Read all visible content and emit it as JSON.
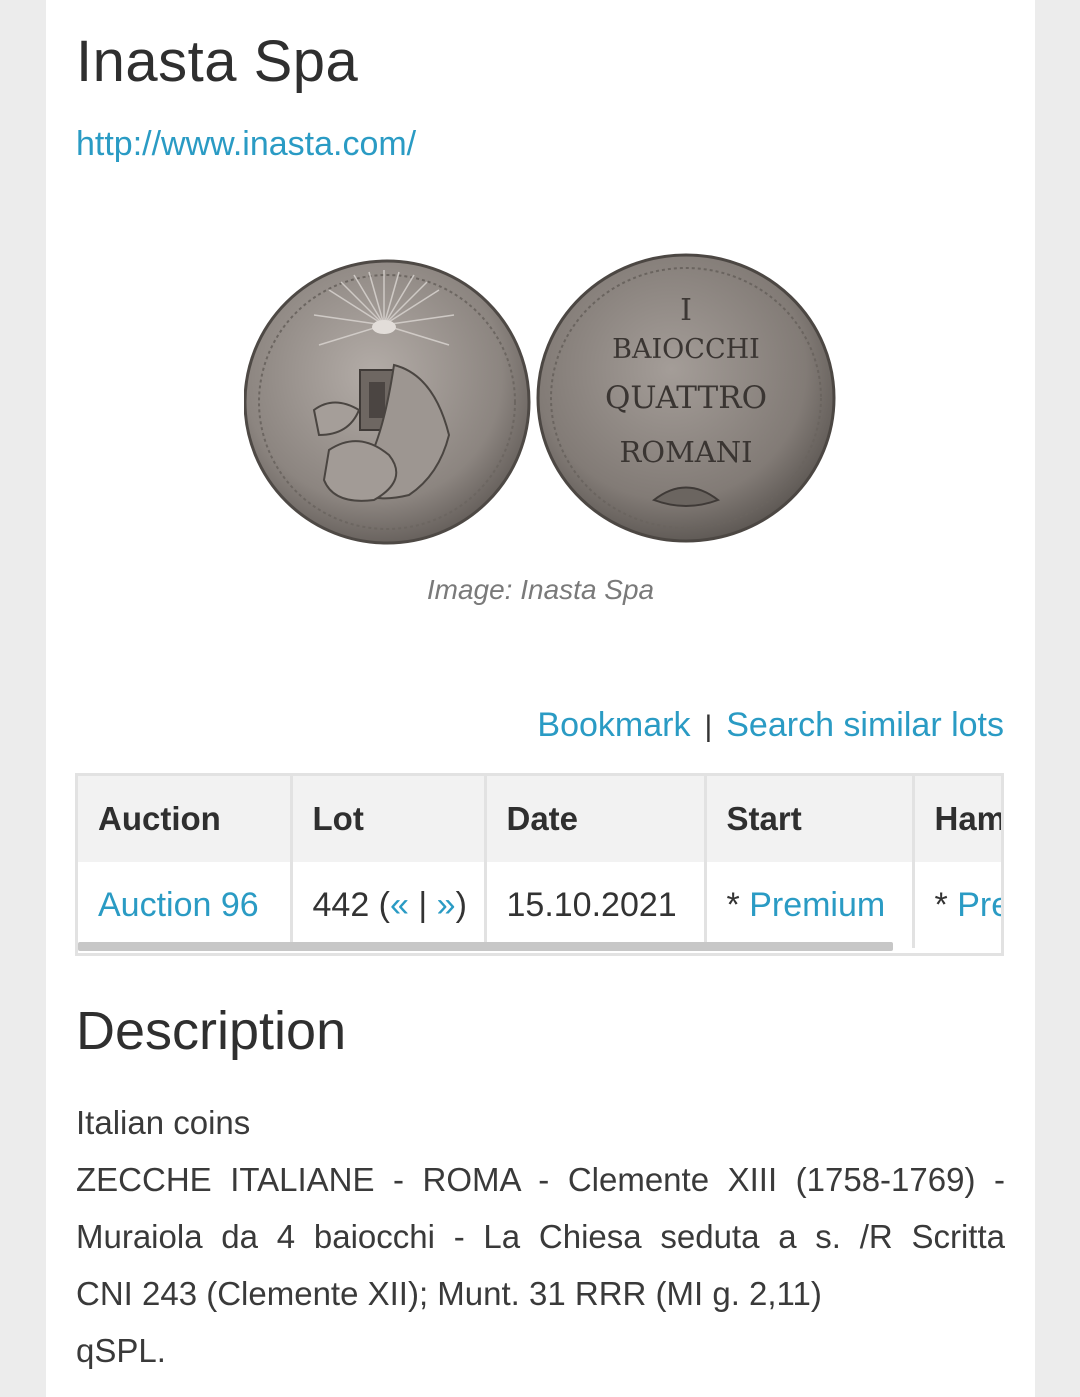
{
  "header": {
    "title": "Inasta Spa",
    "url": "http://www.inasta.com/"
  },
  "image": {
    "caption": "Image: Inasta Spa",
    "reverse_lines": [
      "BAIOCCHI",
      "QUATTRO",
      "ROMANI"
    ],
    "coin_color": "#8c8580"
  },
  "actions": {
    "bookmark": "Bookmark",
    "separator": "|",
    "search_similar": "Search similar lots"
  },
  "table": {
    "headers": [
      "Auction",
      "Lot",
      "Date",
      "Start",
      "Ham"
    ],
    "row": {
      "auction": "Auction 96",
      "lot_number": "442 (",
      "prev": "«",
      "lot_sep": " | ",
      "next": "»",
      "lot_close": ")",
      "date": "15.10.2021",
      "start_prefix": "* ",
      "start_link": "Premium",
      "hammer_prefix": "* ",
      "hammer_link": "Premium"
    }
  },
  "description": {
    "heading": "Description",
    "category": "Italian coins",
    "line1": "ZECCHE ITALIANE - ROMA - Clemente XIII (1758-1769) -",
    "line2": "Muraiola da 4 baiocchi - La Chiesa seduta a s. /R Scritta",
    "line3": "CNI 243 (Clemente XII); Munt. 31 RRR (MI g. 2,11)",
    "line4": "qSPL."
  },
  "colors": {
    "link": "#2a9bc4",
    "table_header_bg": "#f2f2f2",
    "border": "#e2e2e2"
  }
}
